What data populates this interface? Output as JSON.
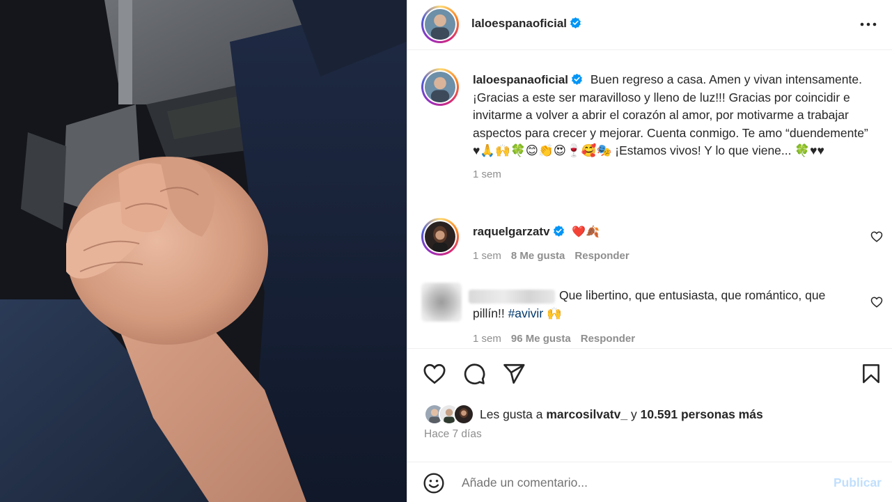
{
  "post": {
    "author": "laloespanaoficial",
    "verified": true
  },
  "caption": {
    "author": "laloespanaoficial",
    "text": "Buen regreso a casa. Amen y vivan intensamente. ¡Gracias a este ser maravilloso y lleno de luz!!! Gracias por coincidir e invitarme a volver a abrir el corazón al amor, por motivarme a trabajar aspectos para crecer y mejorar. Cuenta conmigo. Te amo “duendemente” ♥🙏🙌🍀😊👏😍🍷🥰🎭 ¡Estamos vivos! Y lo que viene... 🍀♥♥",
    "time": "1 sem"
  },
  "comments": [
    {
      "author": "raquelgarzatv",
      "verified": true,
      "text": "❤️🍂",
      "time": "1 sem",
      "likes": "8 Me gusta",
      "reply": "Responder"
    },
    {
      "author": "",
      "text_before_tag": "Que libertino, que entusiasta, que romántico, que pillín!! ",
      "hashtag": "#avivir",
      "text_after_tag": " 🙌",
      "time": "1 sem",
      "likes": "96 Me gusta",
      "reply": "Responder"
    }
  ],
  "likes": {
    "prefix": "Les gusta a",
    "user": "marcosilvatv_",
    "connector": "y",
    "others": "10.591 personas más"
  },
  "posted_ago": "Hace 7 días",
  "add_comment": {
    "placeholder": "Añade un comentario...",
    "publish": "Publicar"
  },
  "icons": {
    "more": "more-horizontal-icon",
    "like": "heart-outline-icon",
    "comment": "comment-bubble-icon",
    "share": "paper-plane-icon",
    "save": "bookmark-icon",
    "emoji": "smiley-icon",
    "verified": "verified-badge-icon"
  },
  "colors": {
    "verified": "#0095f6",
    "link": "#00376b",
    "muted": "#8e8e8e",
    "publish_disabled": "#c0dffd"
  }
}
